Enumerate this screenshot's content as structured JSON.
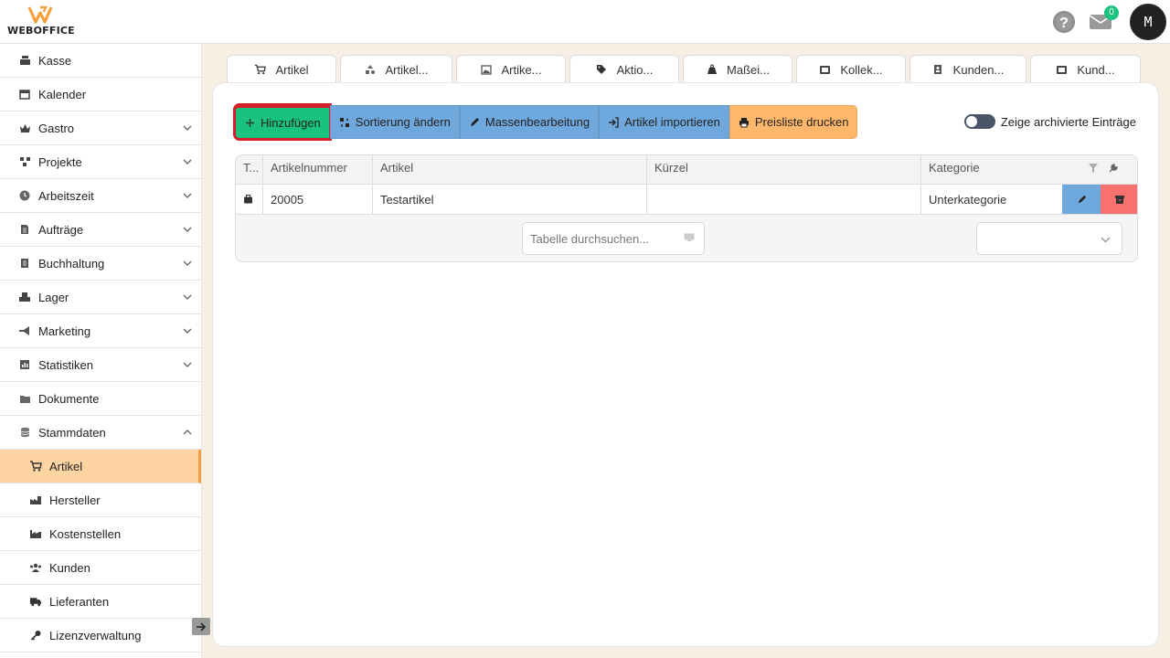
{
  "brand": {
    "name": "WEBOFFICE",
    "accent": "#f5a03c"
  },
  "header": {
    "mail_count": "0",
    "avatar_initial": "M",
    "help_label": "?"
  },
  "sidebar": {
    "items": [
      {
        "label": "Kasse",
        "icon": "cash-register-icon",
        "expandable": false
      },
      {
        "label": "Kalender",
        "icon": "calendar-icon",
        "expandable": false
      },
      {
        "label": "Gastro",
        "icon": "crown-icon",
        "expandable": true
      },
      {
        "label": "Projekte",
        "icon": "project-diagram-icon",
        "expandable": true
      },
      {
        "label": "Arbeitszeit",
        "icon": "clock-icon",
        "expandable": true
      },
      {
        "label": "Aufträge",
        "icon": "file-icon",
        "expandable": true
      },
      {
        "label": "Buchhaltung",
        "icon": "ledger-icon",
        "expandable": true
      },
      {
        "label": "Lager",
        "icon": "boxes-icon",
        "expandable": true
      },
      {
        "label": "Marketing",
        "icon": "megaphone-icon",
        "expandable": true
      },
      {
        "label": "Statistiken",
        "icon": "chart-icon",
        "expandable": true
      },
      {
        "label": "Dokumente",
        "icon": "folder-icon",
        "expandable": false
      },
      {
        "label": "Stammdaten",
        "icon": "database-icon",
        "expandable": true,
        "expanded": true
      }
    ],
    "sub_items": [
      {
        "label": "Artikel",
        "icon": "cart-icon",
        "active": true
      },
      {
        "label": "Hersteller",
        "icon": "factory-icon"
      },
      {
        "label": "Kostenstellen",
        "icon": "industry-icon"
      },
      {
        "label": "Kunden",
        "icon": "users-icon"
      },
      {
        "label": "Lieferanten",
        "icon": "truck-icon"
      },
      {
        "label": "Lizenzverwaltung",
        "icon": "key-icon"
      }
    ]
  },
  "tabs": [
    {
      "label": "Artikel",
      "icon": "cart-icon"
    },
    {
      "label": "Artikel...",
      "icon": "shapes-icon"
    },
    {
      "label": "Artike...",
      "icon": "image-icon"
    },
    {
      "label": "Aktio...",
      "icon": "tag-icon"
    },
    {
      "label": "Maßei...",
      "icon": "weight-icon"
    },
    {
      "label": "Kollek...",
      "icon": "collection-icon"
    },
    {
      "label": "Kunden...",
      "icon": "id-card-icon"
    },
    {
      "label": "Kund...",
      "icon": "collection-icon"
    }
  ],
  "toolbar": {
    "add": "Hinzufügen",
    "sort": "Sortierung ändern",
    "bulk_edit": "Massenbearbeitung",
    "import": "Artikel importieren",
    "print": "Preisliste drucken"
  },
  "archive_toggle": {
    "label": "Zeige archivierte Einträge",
    "on": false
  },
  "table": {
    "columns": [
      "T...",
      "Artikelnummer",
      "Artikel",
      "Kürzel",
      "Kategorie"
    ],
    "rows": [
      {
        "type_icon": "briefcase-icon",
        "number": "20005",
        "name": "Testartikel",
        "short": "",
        "category": "Unterkategorie"
      }
    ],
    "search_placeholder": "Tabelle durchsuchen...",
    "page_size_value": ""
  },
  "colors": {
    "green": "#19c37d",
    "blue": "#6fa8dc",
    "orange": "#ffb86b",
    "red": "#f87171"
  }
}
